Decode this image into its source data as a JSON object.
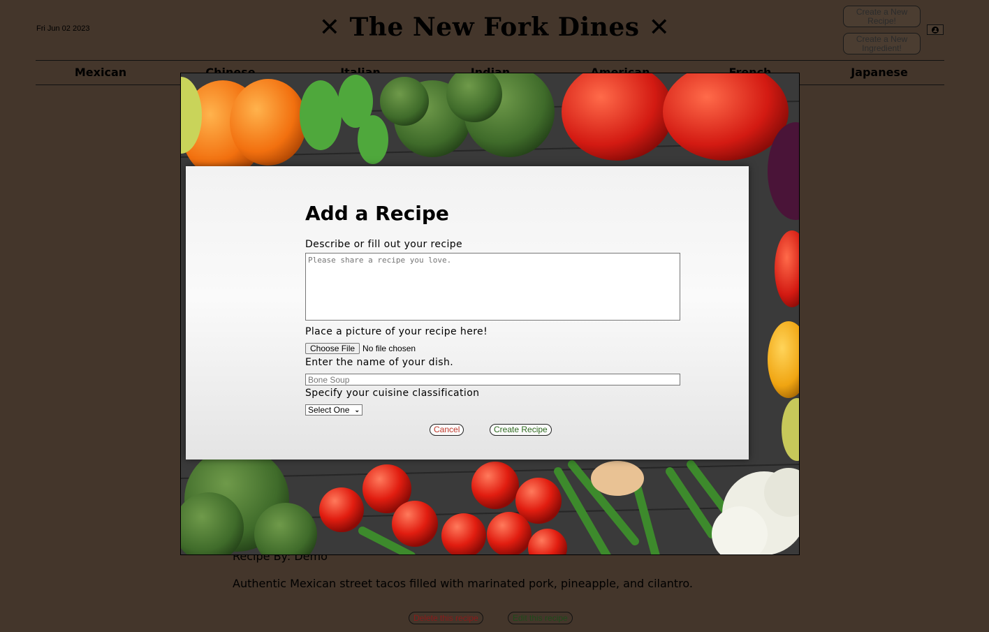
{
  "header": {
    "date": "Fri Jun 02 2023",
    "title": "The New Fork Dines",
    "create_recipe_button": "Create a New Recipe!",
    "create_ingredient_button": "Create a New Ingredient!"
  },
  "nav": {
    "items": [
      "Mexican",
      "Chinese",
      "Italian",
      "Indian",
      "American",
      "French",
      "Japanese"
    ]
  },
  "page": {
    "recipe_by": "Recipe By: Demo",
    "description": "Authentic Mexican street tacos filled with marinated pork, pineapple, and cilantro.",
    "delete_button": "Delete this recipe",
    "edit_button": "Edit this recipe"
  },
  "modal": {
    "title": "Add a Recipe",
    "describe_label": "Describe or fill out your recipe",
    "describe_placeholder": "Please share a recipe you love.",
    "picture_label": "Place a picture of your recipe here!",
    "choose_file": "Choose File",
    "no_file": "No file chosen",
    "name_label": "Enter the name of your dish.",
    "name_placeholder": "Bone Soup",
    "cuisine_label": "Specify your cuisine classification",
    "cuisine_selected": "Select One",
    "cancel_button": "Cancel",
    "create_button": "Create Recipe"
  },
  "colors": {
    "page_bg": "#44362b",
    "cancel_text": "#c0392b",
    "create_text": "#2f6b1f"
  }
}
